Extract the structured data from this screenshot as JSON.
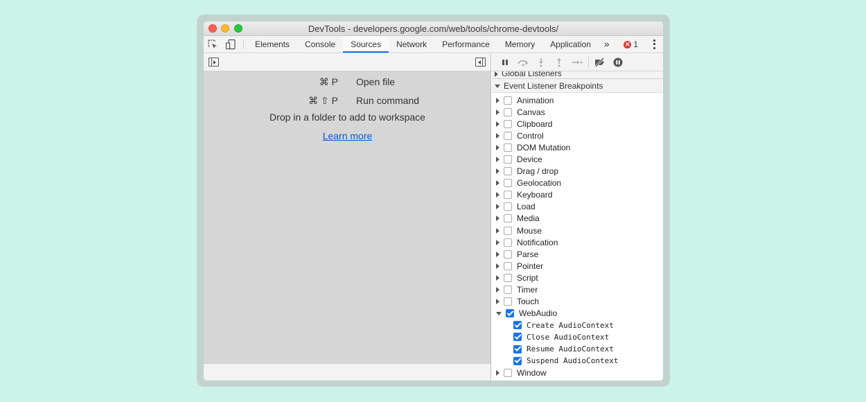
{
  "window": {
    "title": "DevTools - developers.google.com/web/tools/chrome-devtools/"
  },
  "tabs": [
    {
      "label": "Elements",
      "active": false
    },
    {
      "label": "Console",
      "active": false
    },
    {
      "label": "Sources",
      "active": true
    },
    {
      "label": "Network",
      "active": false
    },
    {
      "label": "Performance",
      "active": false
    },
    {
      "label": "Memory",
      "active": false
    },
    {
      "label": "Application",
      "active": false
    }
  ],
  "more_tabs": "»",
  "error_count": "1",
  "error_glyph": "✕",
  "colors": {
    "accent": "#1a73e8",
    "error": "#e0342e",
    "link": "#1155cc"
  },
  "editor": {
    "shortcuts": [
      {
        "keys": "⌘ P",
        "label": "Open file"
      },
      {
        "keys": "⌘ ⇧ P",
        "label": "Run command"
      }
    ],
    "drop_text": "Drop in a folder to add to workspace",
    "learn_more": "Learn more"
  },
  "debugger": {
    "global_listeners": "Global Listeners",
    "event_listener_breakpoints": "Event Listener Breakpoints",
    "categories": [
      {
        "label": "Animation",
        "checked": false
      },
      {
        "label": "Canvas",
        "checked": false
      },
      {
        "label": "Clipboard",
        "checked": false
      },
      {
        "label": "Control",
        "checked": false
      },
      {
        "label": "DOM Mutation",
        "checked": false
      },
      {
        "label": "Device",
        "checked": false
      },
      {
        "label": "Drag / drop",
        "checked": false
      },
      {
        "label": "Geolocation",
        "checked": false
      },
      {
        "label": "Keyboard",
        "checked": false
      },
      {
        "label": "Load",
        "checked": false
      },
      {
        "label": "Media",
        "checked": false
      },
      {
        "label": "Mouse",
        "checked": false
      },
      {
        "label": "Notification",
        "checked": false
      },
      {
        "label": "Parse",
        "checked": false
      },
      {
        "label": "Pointer",
        "checked": false
      },
      {
        "label": "Script",
        "checked": false
      },
      {
        "label": "Timer",
        "checked": false
      },
      {
        "label": "Touch",
        "checked": false
      }
    ],
    "webaudio": {
      "label": "WebAudio",
      "checked": true,
      "children": [
        {
          "label": "Create AudioContext",
          "checked": true
        },
        {
          "label": "Close AudioContext",
          "checked": true
        },
        {
          "label": "Resume AudioContext",
          "checked": true
        },
        {
          "label": "Suspend AudioContext",
          "checked": true
        }
      ]
    },
    "window_item": {
      "label": "Window",
      "checked": false
    }
  }
}
